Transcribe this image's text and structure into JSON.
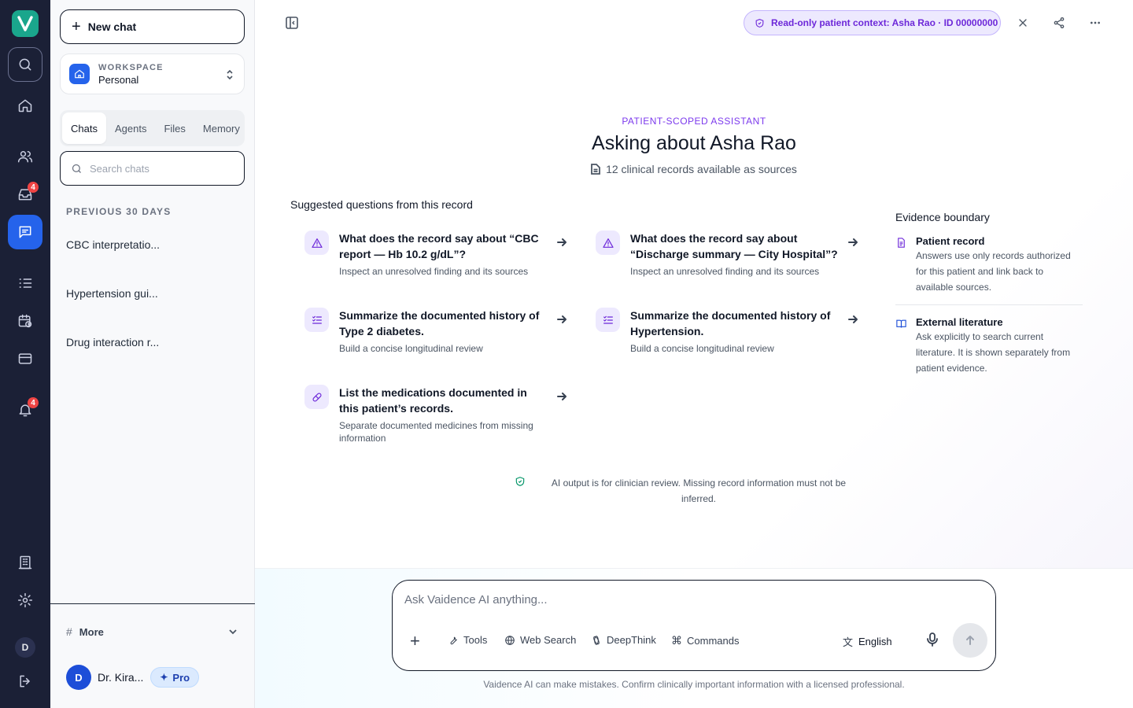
{
  "rail": {
    "inbox_badge": "4",
    "notifications_badge": "4",
    "avatar_initial": "D"
  },
  "sidebar": {
    "new_chat_label": "New chat",
    "workspace": {
      "label": "WORKSPACE",
      "value": "Personal"
    },
    "tabs": [
      {
        "label": "Chats",
        "active": true
      },
      {
        "label": "Agents",
        "active": false
      },
      {
        "label": "Files",
        "active": false
      },
      {
        "label": "Memory",
        "active": false
      }
    ],
    "search_placeholder": "Search chats",
    "section_label": "PREVIOUS 30 DAYS",
    "chats": [
      {
        "title": "CBC interpretatio..."
      },
      {
        "title": "Hypertension gui..."
      },
      {
        "title": "Drug interaction r..."
      }
    ],
    "more_label": "More",
    "user": {
      "initial": "D",
      "name": "Dr. Kira...",
      "plan": "Pro"
    }
  },
  "topbar": {
    "context_pill": "Read-only patient context: Asha Rao · ID 00000000"
  },
  "hero": {
    "eyebrow": "PATIENT-SCOPED ASSISTANT",
    "title": "Asking about Asha Rao",
    "subtitle": "12 clinical records available as sources"
  },
  "suggestions": {
    "title": "Suggested questions from this record",
    "items": [
      {
        "icon": "warning-icon",
        "title": "What does the record say about “CBC report — Hb 10.2 g/dL”?",
        "subtitle": "Inspect an unresolved finding and its sources"
      },
      {
        "icon": "warning-icon",
        "title": "What does the record say about “Discharge summary — City Hospital”?",
        "subtitle": "Inspect an unresolved finding and its sources"
      },
      {
        "icon": "checklist-icon",
        "title": "Summarize the documented history of Type 2 diabetes.",
        "subtitle": "Build a concise longitudinal review"
      },
      {
        "icon": "checklist-icon",
        "title": "Summarize the documented history of Hypertension.",
        "subtitle": "Build a concise longitudinal review"
      },
      {
        "icon": "pill-icon",
        "title": "List the medications documented in this patient’s records.",
        "subtitle": "Separate documented medicines from missing information"
      }
    ]
  },
  "evidence": {
    "title": "Evidence boundary",
    "items": [
      {
        "name": "Patient record",
        "desc": "Answers use only records authorized for this patient and link back to available sources."
      },
      {
        "name": "External literature",
        "desc": "Ask explicitly to search current literature. It is shown separately from patient evidence."
      }
    ]
  },
  "disclaimer": "AI output is for clinician review. Missing record information must not be inferred.",
  "composer": {
    "placeholder": "Ask Vaidence AI anything...",
    "tools": [
      "Tools",
      "Web Search",
      "DeepThink",
      "Commands"
    ],
    "language": "English"
  },
  "footnote": "Vaidence AI can make mistakes. Confirm clinically important information with a licensed professional.",
  "colors": {
    "accent": "#7c3aed",
    "primary": "#2563eb",
    "rail": "#1b2036",
    "logo": "#1aa68c"
  }
}
